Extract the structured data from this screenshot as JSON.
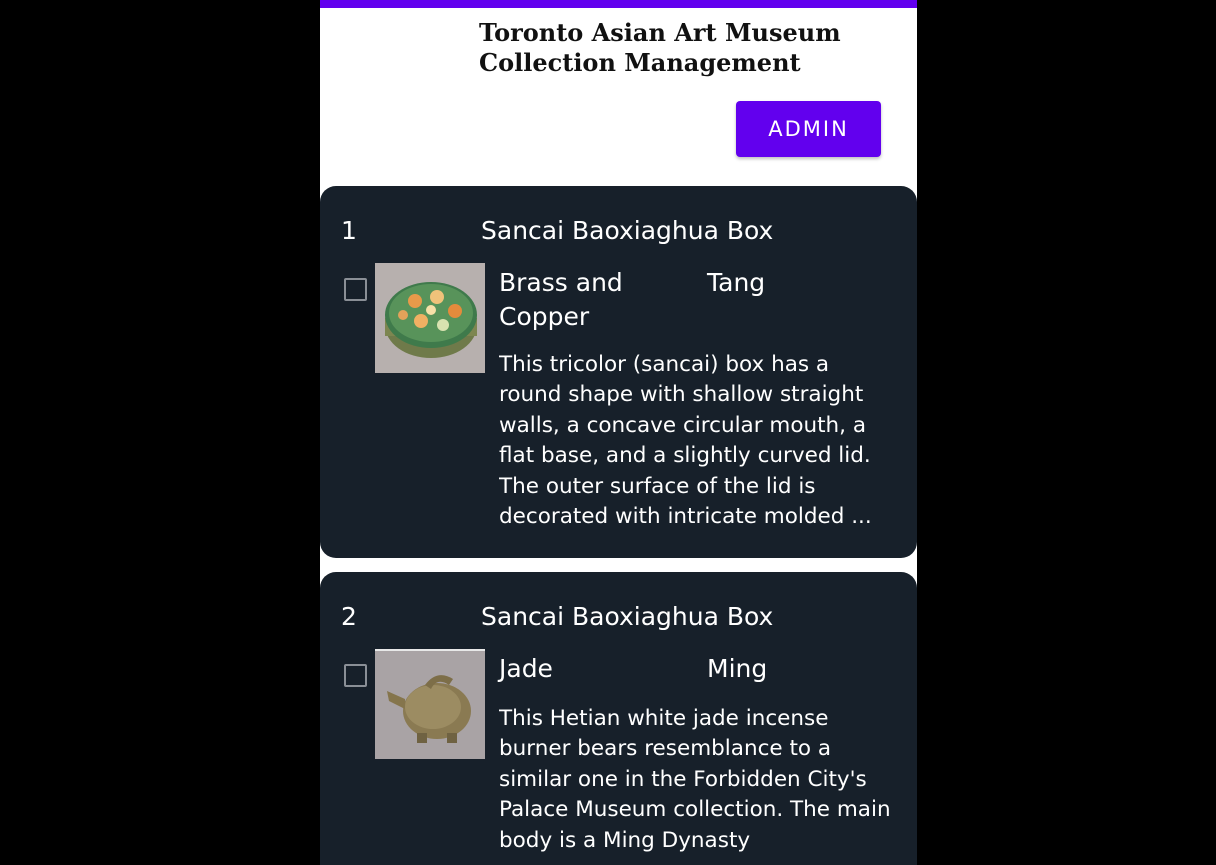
{
  "app": {
    "title_line1": "Toronto Asian Art Museum",
    "title_line2": "Collection Management",
    "admin_label": "ADMIN",
    "accent_color": "#6200ee",
    "card_color": "#17202a"
  },
  "items": [
    {
      "index": "1",
      "name": "Sancai Baoxiaghua Box",
      "material": "Brass and Copper",
      "dynasty": "Tang",
      "checked": false,
      "image_icon": "round-lidded-box-image",
      "description": "This tricolor (sancai) box has a round shape with shallow straight walls, a concave circular mouth, a flat base, and a slightly curved lid. The outer surface of the lid is decorated with intricate molded ..."
    },
    {
      "index": "2",
      "name": "Sancai Baoxiaghua Box",
      "material": "Jade",
      "dynasty": "Ming",
      "checked": false,
      "image_icon": "jade-incense-burner-image",
      "description": "This Hetian white jade incense burner bears resemblance to a similar one in the Forbidden City's Palace Museum collection. The main body is a Ming Dynasty"
    }
  ]
}
